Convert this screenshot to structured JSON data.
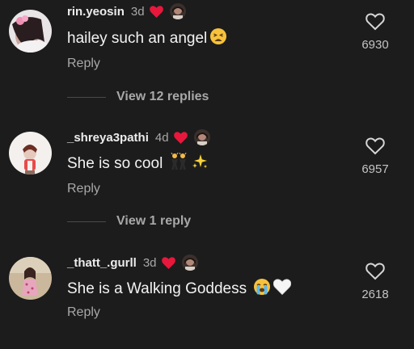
{
  "comments": [
    {
      "username": "rin.yeosin",
      "age": "3d",
      "text": "hailey such an angel",
      "emoji": "weary-face",
      "reply_label": "Reply",
      "like_count": "6930",
      "view_replies": "View 12 replies"
    },
    {
      "username": "_shreya3pathi",
      "age": "4d",
      "text": "She is so cool",
      "emoji": "dancers-sparkles",
      "reply_label": "Reply",
      "like_count": "6957",
      "view_replies": "View 1 reply"
    },
    {
      "username": "_thatt_.gurll",
      "age": "3d",
      "text": "She is a Walking Goddess",
      "emoji": "crying-face-white-heart",
      "reply_label": "Reply",
      "like_count": "2618"
    }
  ],
  "icons": {
    "creator_heart": "heart-icon",
    "like": "heart-outline-icon"
  },
  "colors": {
    "background": "#1c1c1c",
    "creator_heart": "#e8173c",
    "muted_text": "#a8a8a8"
  }
}
